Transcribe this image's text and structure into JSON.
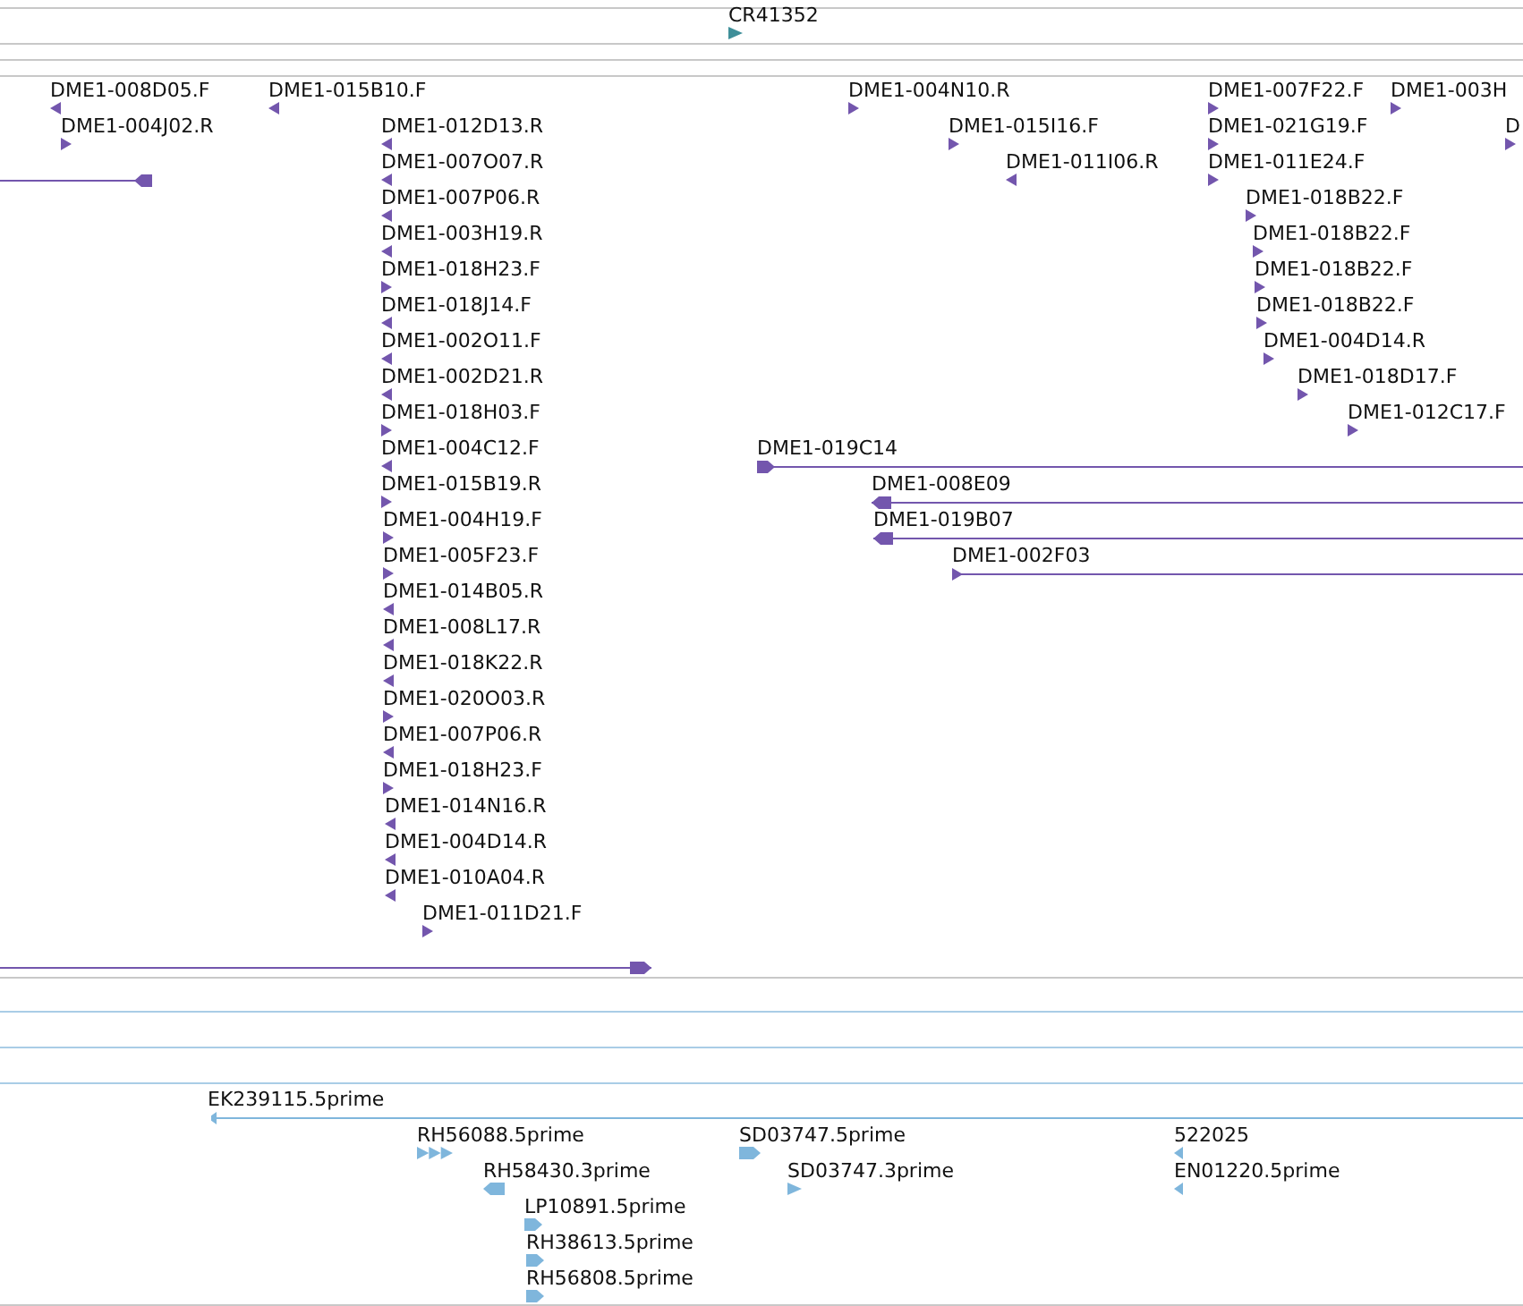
{
  "tracks": [
    {
      "color": "#3f8f99",
      "features": [
        {
          "label": "CR41352",
          "reverse": false,
          "kind": "point"
        }
      ]
    },
    {
      "color": "#7356ad",
      "features": [
        {
          "label": "DME1-008D05.F",
          "reverse": true,
          "kind": "point"
        },
        {
          "label": "DME1-015B10.F",
          "reverse": true,
          "kind": "point"
        },
        {
          "label": "DME1-004N10.R",
          "reverse": false,
          "kind": "point"
        },
        {
          "label": "DME1-007F22.F",
          "reverse": false,
          "kind": "point"
        },
        {
          "label": "DME1-003H",
          "reverse": false,
          "kind": "point"
        },
        {
          "label": "DME1-004J02.R",
          "reverse": false,
          "kind": "point"
        },
        {
          "label": "DME1-012D13.R",
          "reverse": true,
          "kind": "point"
        },
        {
          "label": "DME1-015I16.F",
          "reverse": false,
          "kind": "point"
        },
        {
          "label": "DME1-021G19.F",
          "reverse": false,
          "kind": "point"
        },
        {
          "label": "D",
          "reverse": false,
          "kind": "point"
        },
        {
          "reverse": true,
          "kind": "span"
        },
        {
          "label": "DME1-007O07.R",
          "reverse": true,
          "kind": "point"
        },
        {
          "label": "DME1-011I06.R",
          "reverse": true,
          "kind": "point"
        },
        {
          "label": "DME1-011E24.F",
          "reverse": false,
          "kind": "point"
        },
        {
          "label": "DME1-007P06.R",
          "reverse": true,
          "kind": "point"
        },
        {
          "label": "DME1-018B22.F",
          "reverse": false,
          "kind": "point"
        },
        {
          "label": "DME1-003H19.R",
          "reverse": true,
          "kind": "point"
        },
        {
          "label": "DME1-018B22.F",
          "reverse": false,
          "kind": "point"
        },
        {
          "label": "DME1-018H23.F",
          "reverse": false,
          "kind": "point"
        },
        {
          "label": "DME1-018B22.F",
          "reverse": false,
          "kind": "point"
        },
        {
          "label": "DME1-018J14.F",
          "reverse": true,
          "kind": "point"
        },
        {
          "label": "DME1-018B22.F",
          "reverse": false,
          "kind": "point"
        },
        {
          "label": "DME1-002O11.F",
          "reverse": true,
          "kind": "point"
        },
        {
          "label": "DME1-004D14.R",
          "reverse": false,
          "kind": "point"
        },
        {
          "label": "DME1-002D21.R",
          "reverse": true,
          "kind": "point"
        },
        {
          "label": "DME1-018D17.F",
          "reverse": false,
          "kind": "point"
        },
        {
          "label": "DME1-018H03.F",
          "reverse": false,
          "kind": "point"
        },
        {
          "label": "DME1-012C17.F",
          "reverse": false,
          "kind": "point"
        },
        {
          "label": "DME1-004C12.F",
          "reverse": true,
          "kind": "point"
        },
        {
          "label": "DME1-019C14",
          "reverse": false,
          "kind": "span"
        },
        {
          "label": "DME1-015B19.R",
          "reverse": false,
          "kind": "point"
        },
        {
          "label": "DME1-008E09",
          "reverse": true,
          "kind": "span"
        },
        {
          "label": "DME1-004H19.F",
          "reverse": false,
          "kind": "point"
        },
        {
          "label": "DME1-019B07",
          "reverse": true,
          "kind": "span"
        },
        {
          "label": "DME1-005F23.F",
          "reverse": false,
          "kind": "point"
        },
        {
          "label": "DME1-002F03",
          "reverse": false,
          "kind": "span"
        },
        {
          "label": "DME1-014B05.R",
          "reverse": true,
          "kind": "point"
        },
        {
          "label": "DME1-008L17.R",
          "reverse": true,
          "kind": "point"
        },
        {
          "label": "DME1-018K22.R",
          "reverse": true,
          "kind": "point"
        },
        {
          "label": "DME1-020O03.R",
          "reverse": false,
          "kind": "point"
        },
        {
          "label": "DME1-007P06.R",
          "reverse": true,
          "kind": "point"
        },
        {
          "label": "DME1-018H23.F",
          "reverse": false,
          "kind": "point"
        },
        {
          "label": "DME1-014N16.R",
          "reverse": true,
          "kind": "point"
        },
        {
          "label": "DME1-004D14.R",
          "reverse": true,
          "kind": "point"
        },
        {
          "label": "DME1-010A04.R",
          "reverse": true,
          "kind": "point"
        },
        {
          "label": "DME1-011D21.F",
          "reverse": false,
          "kind": "point"
        },
        {
          "reverse": false,
          "kind": "span"
        }
      ]
    },
    {
      "color": "#7fb6dc",
      "features": [
        {
          "label": "EK239115.5prime",
          "reverse": true,
          "kind": "span"
        },
        {
          "label": "RH56088.5prime",
          "reverse": false,
          "kind": "point"
        },
        {
          "label": "SD03747.5prime",
          "reverse": false,
          "kind": "point"
        },
        {
          "label": "522025",
          "reverse": true,
          "kind": "point"
        },
        {
          "label": "RH58430.3prime",
          "reverse": true,
          "kind": "point"
        },
        {
          "label": "SD03747.3prime",
          "reverse": false,
          "kind": "point"
        },
        {
          "label": "EN01220.5prime",
          "reverse": true,
          "kind": "point"
        },
        {
          "label": "LP10891.5prime",
          "reverse": false,
          "kind": "point"
        },
        {
          "label": "RH38613.5prime",
          "reverse": false,
          "kind": "point"
        },
        {
          "label": "RH56808.5prime",
          "reverse": false,
          "kind": "point"
        }
      ]
    }
  ]
}
